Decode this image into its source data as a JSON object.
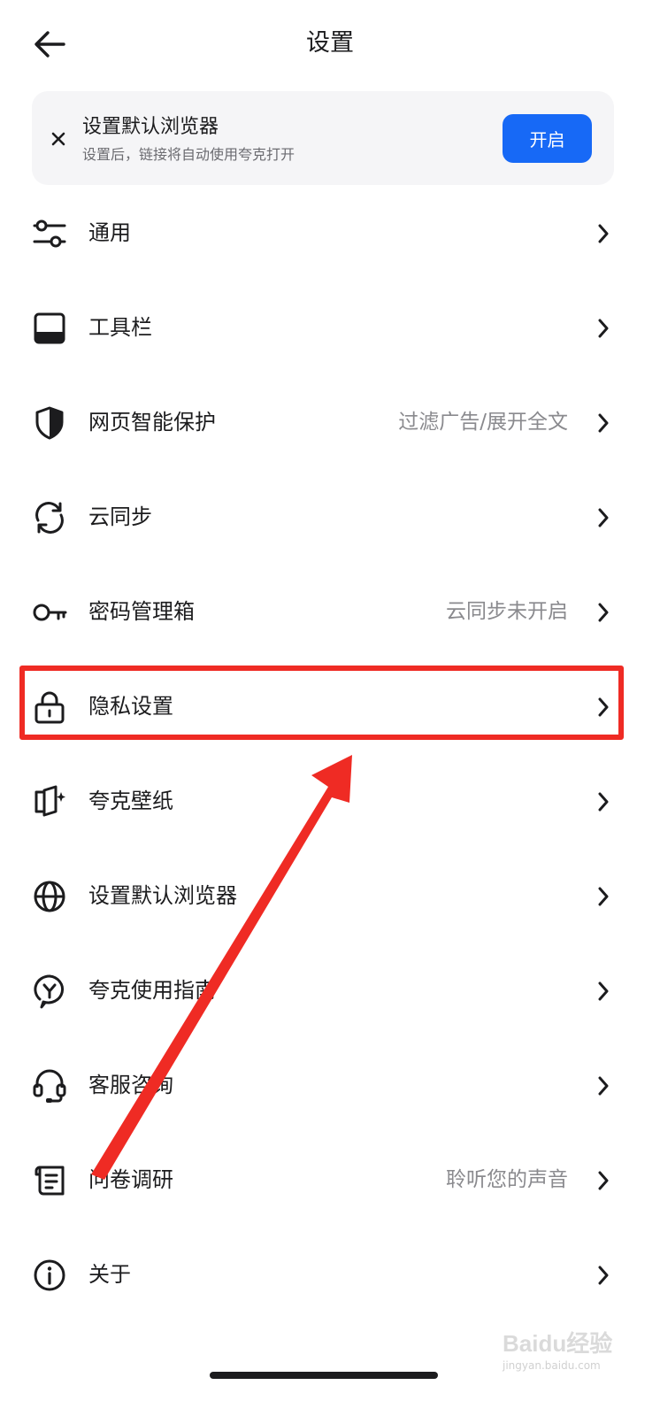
{
  "header": {
    "title": "设置",
    "back_icon": "arrow-left-icon"
  },
  "banner": {
    "title": "设置默认浏览器",
    "subtitle": "设置后，链接将自动使用夸克打开",
    "button_label": "开启",
    "close_icon": "close-icon",
    "button_color": "#1769f6"
  },
  "settings": {
    "items": [
      {
        "label": "通用",
        "value": "",
        "icon": "sliders-icon"
      },
      {
        "label": "工具栏",
        "value": "",
        "icon": "toolbar-icon"
      },
      {
        "label": "网页智能保护",
        "value": "过滤广告/展开全文",
        "icon": "shield-icon"
      },
      {
        "label": "云同步",
        "value": "",
        "icon": "sync-icon"
      },
      {
        "label": "密码管理箱",
        "value": "云同步未开启",
        "icon": "key-icon"
      },
      {
        "label": "隐私设置",
        "value": "",
        "icon": "lock-icon"
      },
      {
        "label": "夸克壁纸",
        "value": "",
        "icon": "wallpaper-icon"
      },
      {
        "label": "设置默认浏览器",
        "value": "",
        "icon": "globe-icon"
      },
      {
        "label": "夸克使用指南",
        "value": "",
        "icon": "guide-icon"
      },
      {
        "label": "客服咨询",
        "value": "",
        "icon": "headset-icon"
      },
      {
        "label": "问卷调研",
        "value": "聆听您的声音",
        "icon": "survey-icon"
      },
      {
        "label": "关于",
        "value": "",
        "icon": "info-icon"
      }
    ]
  },
  "annotation": {
    "highlighted_item": "隐私设置",
    "color": "#ef2b24"
  },
  "watermark": {
    "brand": "Baidu经验",
    "url": "jingyan.baidu.com"
  }
}
